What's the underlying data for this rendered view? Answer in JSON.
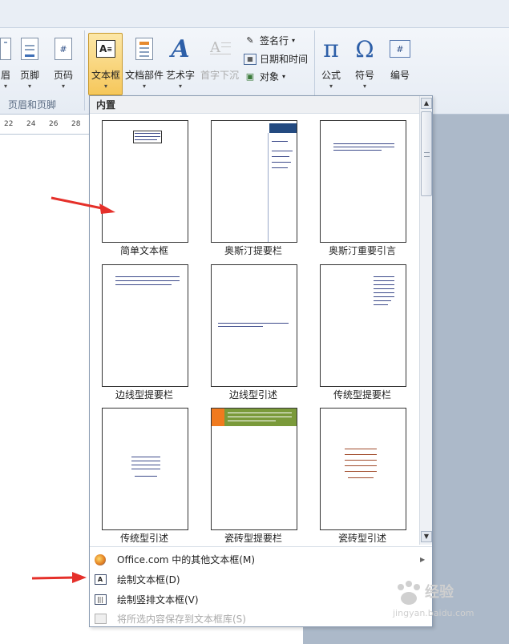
{
  "ribbon": {
    "partial_left_label": "眉",
    "footer_label": "页脚",
    "pagenum_label": "页码",
    "textbox_label": "文本框",
    "docparts_label": "文档部件",
    "wordart_label": "艺术字",
    "dropcap_label": "首字下沉",
    "signature_label": "签名行",
    "datetime_label": "日期和时间",
    "object_label": "对象",
    "formula_label": "公式",
    "symbol_label": "符号",
    "number_label": "编号",
    "group_header_footer": "页眉和页脚",
    "pi_glyph": "π",
    "omega_glyph": "Ω",
    "wordart_glyph": "A"
  },
  "ruler": {
    "ticks": [
      "22",
      "24",
      "26",
      "28"
    ]
  },
  "dropdown": {
    "section_header": "内置",
    "tiles": [
      {
        "label": "简单文本框"
      },
      {
        "label": "奥斯汀提要栏"
      },
      {
        "label": "奥斯汀重要引言"
      },
      {
        "label": "边线型提要栏"
      },
      {
        "label": "边线型引述"
      },
      {
        "label": "传统型提要栏"
      },
      {
        "label": "传统型引述"
      },
      {
        "label": "瓷砖型提要栏"
      },
      {
        "label": "瓷砖型引述"
      }
    ],
    "menu": {
      "more_textboxes": "Office.com 中的其他文本框(M)",
      "draw_textbox": "绘制文本框(D)",
      "draw_vertical_textbox": "绘制竖排文本框(V)",
      "save_selection": "将所选内容保存到文本框库(S)"
    }
  },
  "watermark": {
    "brand": "经验",
    "url": "jingyan.baidu.com"
  },
  "colors": {
    "accent_orange": "#f07a1e",
    "accent_green": "#7a9a3a",
    "arrow_red": "#e5302a",
    "selected_button": "#f9d98a"
  }
}
